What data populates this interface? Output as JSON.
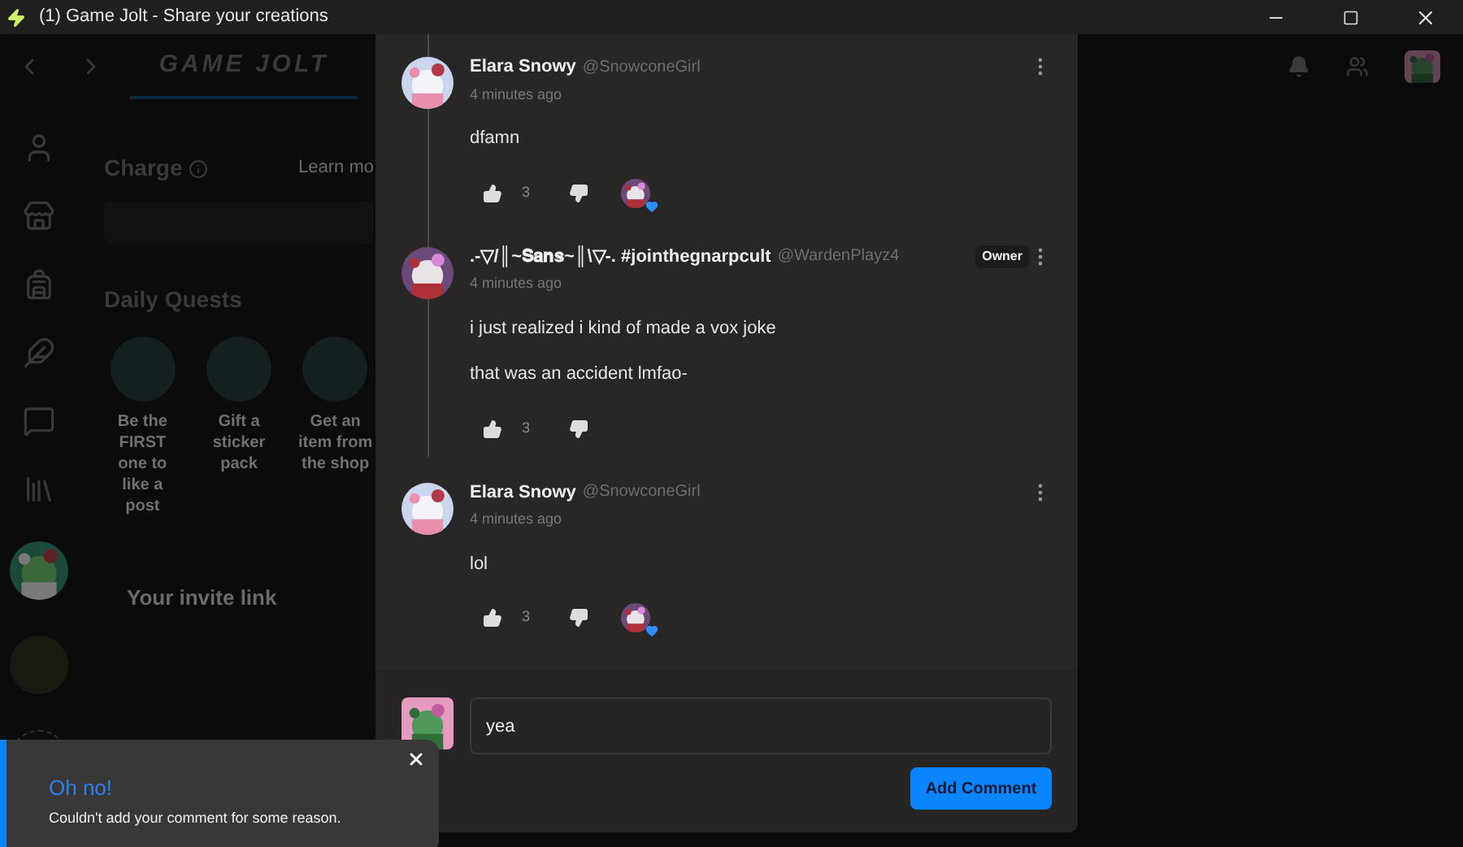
{
  "window": {
    "title": "(1) Game Jolt - Share your creations"
  },
  "nav": {
    "logo": "GAME JOLT"
  },
  "background": {
    "charge": {
      "title": "Charge",
      "link": "Learn mo"
    },
    "daily_quests": {
      "title": "Daily Quests",
      "quests": [
        {
          "label": "Be the FIRST one to like a post"
        },
        {
          "label": "Gift a sticker pack"
        },
        {
          "label": "Get an item from the shop"
        }
      ]
    },
    "invite": {
      "title": "Your invite link"
    }
  },
  "comments": [
    {
      "name": "Elara Snowy",
      "handle": "@SnowconeGirl",
      "time": "4 minutes ago",
      "paragraphs": [
        "dfamn"
      ],
      "likes": "3",
      "owner_liked": true
    },
    {
      "name": ".-▽/║~𝐒𝐚𝐧𝐬~║\\▽-. #jointhegnarpcult",
      "handle": "@WardenPlayz4",
      "badge": "Owner",
      "time": "4 minutes ago",
      "paragraphs": [
        "i just realized i kind of made a vox joke",
        "that was an accident lmfao-"
      ],
      "likes": "3",
      "owner_liked": false
    },
    {
      "name": "Elara Snowy",
      "handle": "@SnowconeGirl",
      "time": "4 minutes ago",
      "paragraphs": [
        "lol"
      ],
      "likes": "3",
      "owner_liked": true
    }
  ],
  "composer": {
    "value": "yea",
    "button": "Add Comment"
  },
  "toast": {
    "title": "Oh no!",
    "message": "Couldn't add your comment for some reason."
  }
}
